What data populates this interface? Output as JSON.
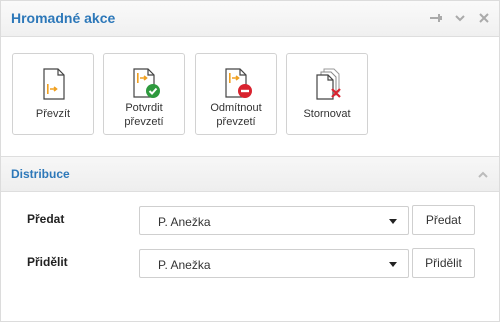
{
  "panel": {
    "title": "Hromadné akce",
    "header_icons": [
      "pin-icon",
      "chevron-down-icon",
      "close-icon"
    ]
  },
  "actions": [
    {
      "label": "Převzít",
      "icon": "document-arrow-icon"
    },
    {
      "label": "Potvrdit\npřevzetí",
      "icon": "document-check-icon"
    },
    {
      "label": "Odmítnout\npřevzetí",
      "icon": "document-reject-icon"
    },
    {
      "label": "Stornovat",
      "icon": "documents-cancel-icon"
    }
  ],
  "distribution": {
    "title": "Distribuce",
    "rows": [
      {
        "label": "Předat",
        "selected": "P. Anežka",
        "button": "Předat"
      },
      {
        "label": "Přidělit",
        "selected": "P. Anežka",
        "button": "Přidělit"
      }
    ]
  },
  "colors": {
    "title_blue": "#2d78b9",
    "arrow_orange": "#f0a020",
    "check_green": "#2e9a3e",
    "reject_red": "#d9232f"
  }
}
